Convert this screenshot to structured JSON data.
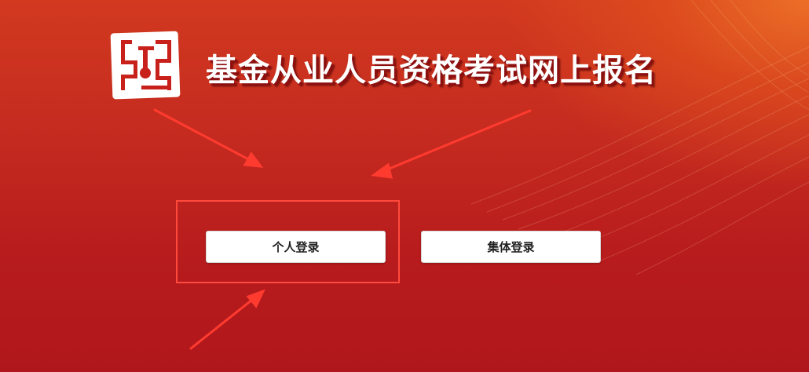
{
  "header": {
    "title": "基金从业人员资格考试网上报名",
    "logo_icon": "seal-logo-icon"
  },
  "login": {
    "individual_label": "个人登录",
    "group_label": "集体登录"
  },
  "colors": {
    "background_top": "#d2391f",
    "background_bottom": "#b0171c",
    "highlight_frame": "#ff4a3c",
    "arrow": "#ff3b30",
    "button_bg": "#ffffff",
    "button_text": "#222222"
  }
}
